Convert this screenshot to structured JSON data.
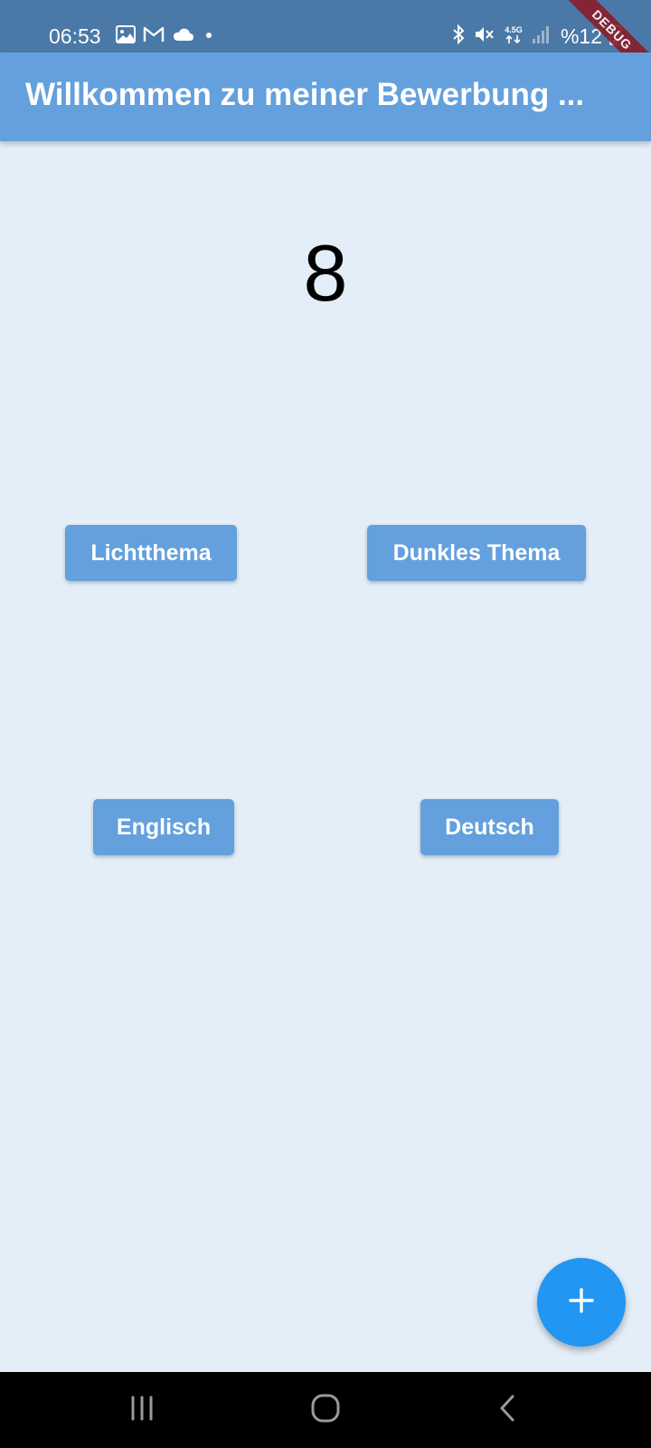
{
  "status_bar": {
    "time": "06:53",
    "battery": "%12",
    "network_type": "4.5G",
    "left_icons": [
      "image-icon",
      "gmail-icon",
      "cloud-icon",
      "dot-icon"
    ],
    "right_icons": [
      "bluetooth-icon",
      "mute-icon",
      "network-icon",
      "signal-icon",
      "battery-icon"
    ]
  },
  "debug_banner": "DEBUG",
  "app_bar": {
    "title": "Willkommen zu meiner Bewerbung ..."
  },
  "counter": {
    "value": "8"
  },
  "buttons": {
    "light_theme": "Lichtthema",
    "dark_theme": "Dunkles Thema",
    "english": "Englisch",
    "german": "Deutsch"
  },
  "fab": {
    "icon": "plus-icon"
  },
  "nav_bar": {
    "items": [
      "recents-icon",
      "home-icon",
      "back-icon"
    ]
  },
  "colors": {
    "status_bar": "#4a79a8",
    "app_bar": "#63a0dd",
    "background": "#e3eef8",
    "button": "#63a0dd",
    "fab": "#2196f3",
    "nav_bar": "#000000"
  }
}
